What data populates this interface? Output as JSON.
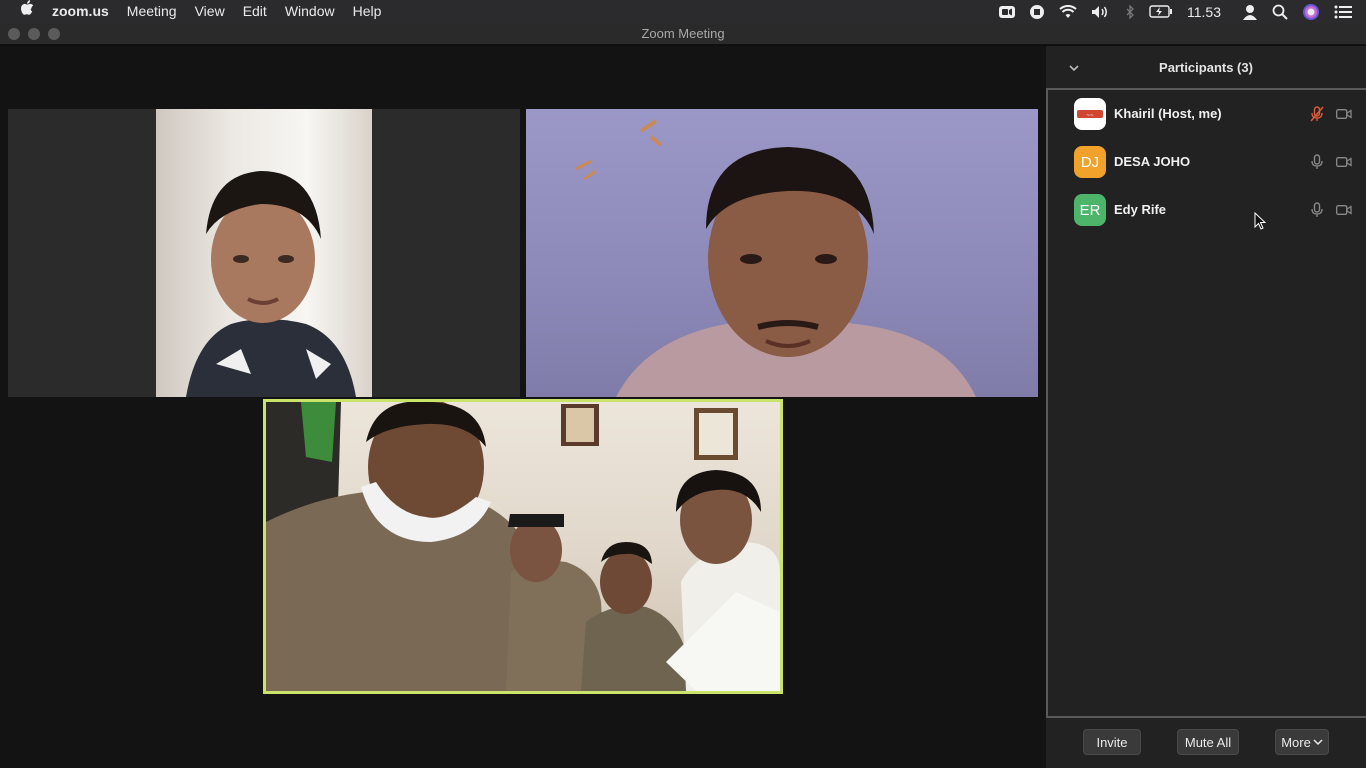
{
  "menubar": {
    "app": "zoom.us",
    "items": [
      "Meeting",
      "View",
      "Edit",
      "Window",
      "Help"
    ],
    "time": "11.53"
  },
  "window": {
    "title": "Zoom Meeting"
  },
  "participants_panel": {
    "title": "Participants (3)",
    "participants": [
      {
        "name": "Khairil (Host, me)",
        "initials": "",
        "avatar_color": "#ffffff",
        "mic": "muted",
        "video": "off"
      },
      {
        "name": "DESA JOHO",
        "initials": "DJ",
        "avatar_color": "#f0a22b",
        "mic": "on",
        "video": "off"
      },
      {
        "name": "Edy Rife",
        "initials": "ER",
        "avatar_color": "#4cb56a",
        "mic": "on",
        "video": "off"
      }
    ],
    "buttons": {
      "invite": "Invite",
      "mute_all": "Mute All",
      "more": "More"
    }
  },
  "colors": {
    "active_speaker_border": "#c9e36b",
    "muted_mic": "#e05c3a"
  }
}
